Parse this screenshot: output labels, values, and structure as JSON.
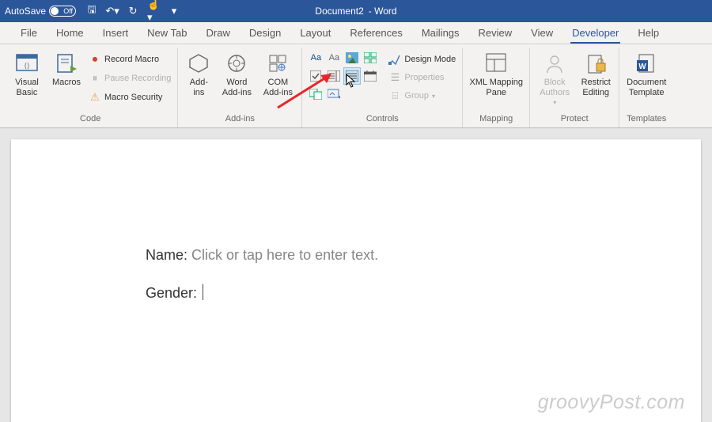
{
  "titlebar": {
    "autosave_label": "AutoSave",
    "autosave_state": "Off",
    "doc_name": "Document2",
    "app_suffix": "- Word"
  },
  "tabs": [
    "File",
    "Home",
    "Insert",
    "New Tab",
    "Draw",
    "Design",
    "Layout",
    "References",
    "Mailings",
    "Review",
    "View",
    "Developer",
    "Help"
  ],
  "active_tab_index": 11,
  "ribbon": {
    "code": {
      "visual_basic": "Visual\nBasic",
      "macros": "Macros",
      "record": "Record Macro",
      "pause": "Pause Recording",
      "security": "Macro Security",
      "group": "Code"
    },
    "addins": {
      "addins": "Add-\nins",
      "word": "Word\nAdd-ins",
      "com": "COM\nAdd-ins",
      "group": "Add-ins"
    },
    "controls": {
      "design": "Design Mode",
      "properties": "Properties",
      "group_btn": "Group",
      "group": "Controls"
    },
    "mapping": {
      "xml": "XML Mapping\nPane",
      "group": "Mapping"
    },
    "protect": {
      "block": "Block\nAuthors",
      "restrict": "Restrict\nEditing",
      "group": "Protect"
    },
    "templates": {
      "doc": "Document\nTemplate",
      "group": "Templates"
    }
  },
  "document": {
    "line1_label": "Name: ",
    "line1_placeholder": "Click or tap here to enter text.",
    "line2_label": "Gender: "
  },
  "watermark": "groovyPost.com"
}
